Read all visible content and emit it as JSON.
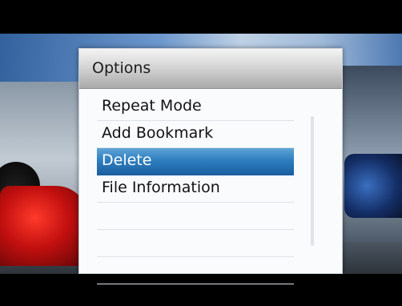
{
  "options_menu": {
    "title": "Options",
    "items": [
      {
        "label": "Repeat Mode",
        "selected": false
      },
      {
        "label": "Add Bookmark",
        "selected": false
      },
      {
        "label": "Delete",
        "selected": true
      },
      {
        "label": "File Information",
        "selected": false
      },
      {
        "label": "",
        "selected": false
      },
      {
        "label": "",
        "selected": false
      },
      {
        "label": "",
        "selected": false
      }
    ]
  },
  "colors": {
    "selection": "#2f7fc0",
    "header": "#c8c8c8",
    "panel": "#fafbfd"
  }
}
